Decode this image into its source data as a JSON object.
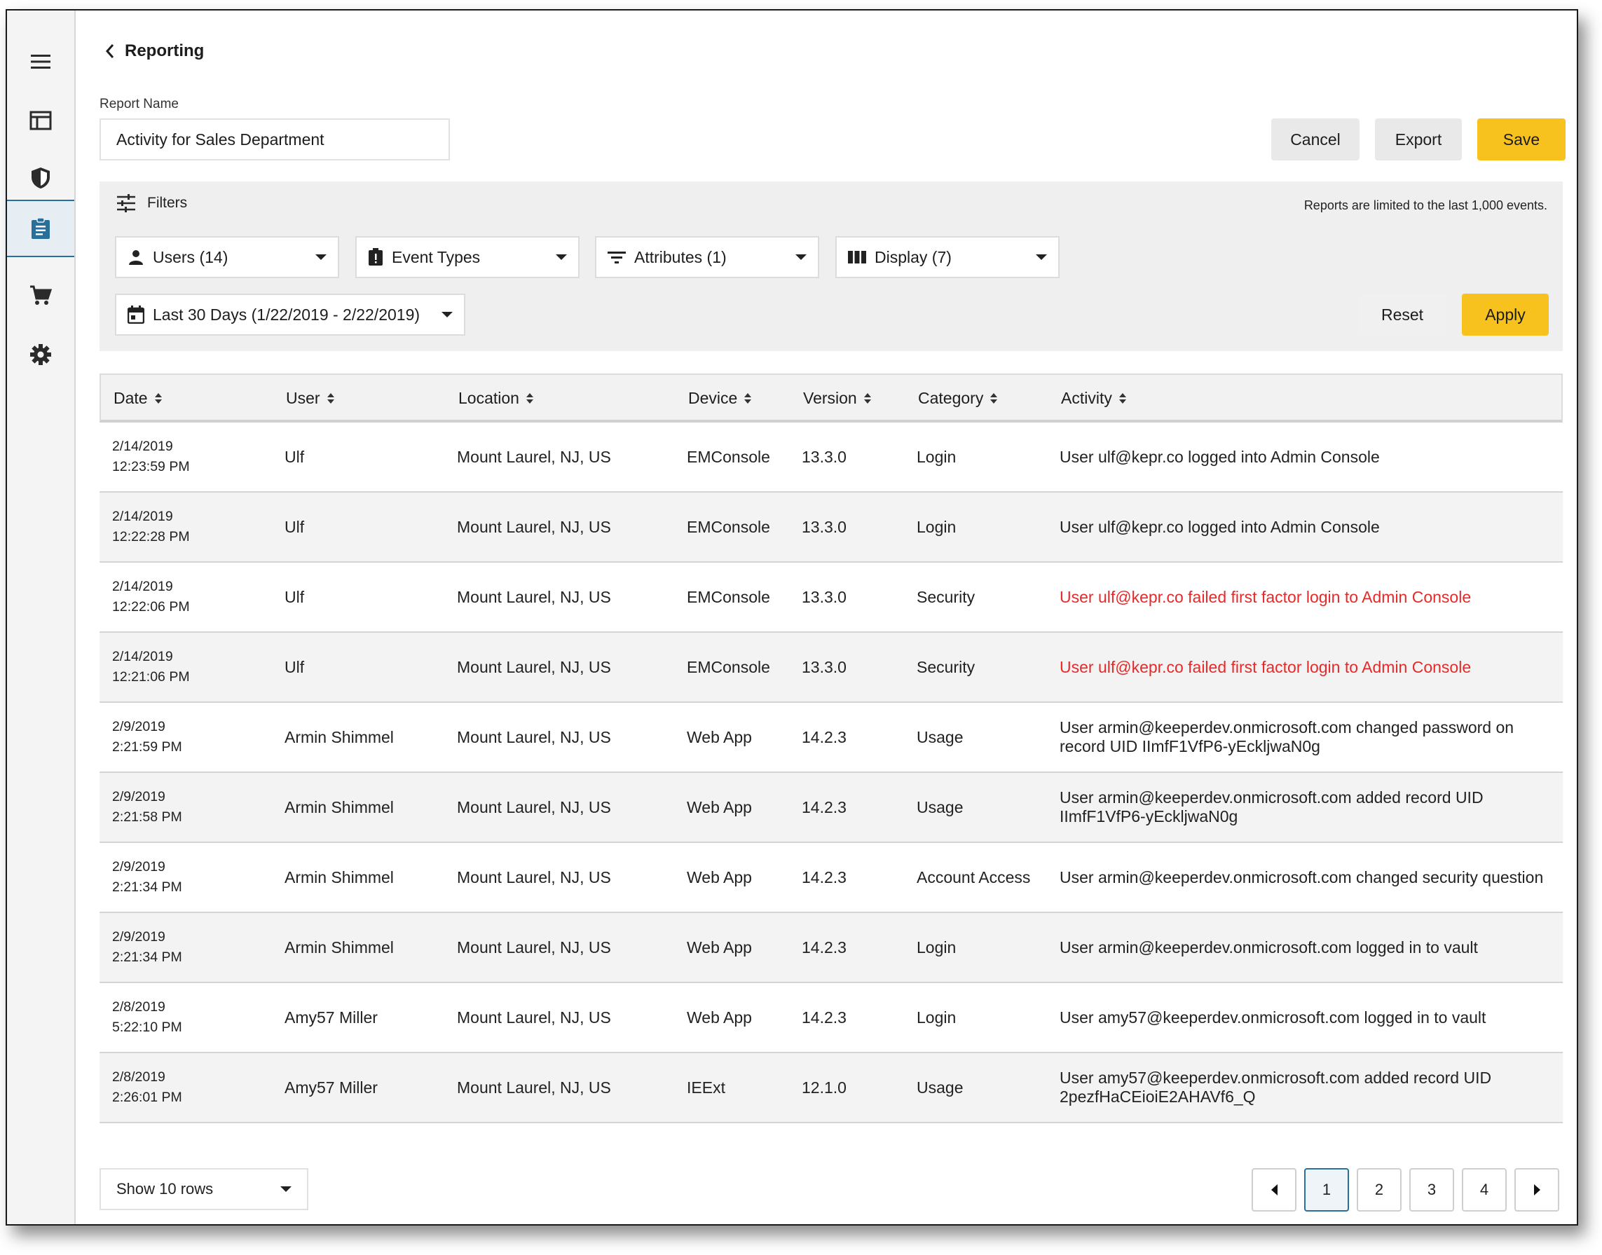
{
  "sidebar": {
    "items": [
      {
        "name": "menu-icon"
      },
      {
        "name": "dashboard-icon"
      },
      {
        "name": "shield-icon"
      },
      {
        "name": "reporting-clipboard-icon"
      },
      {
        "name": "cart-icon"
      },
      {
        "name": "settings-gear-icon"
      }
    ],
    "active_index": 3,
    "accent": "#2a6f99"
  },
  "header": {
    "back_title": "Reporting"
  },
  "report": {
    "label": "Report Name",
    "value": "Activity for Sales Department"
  },
  "actions": {
    "cancel": "Cancel",
    "export": "Export",
    "save": "Save"
  },
  "filters": {
    "title": "Filters",
    "note": "Reports are limited to the last 1,000 events.",
    "users": "Users (14)",
    "event_types": "Event Types",
    "attributes": "Attributes (1)",
    "display": "Display (7)",
    "date_range": "Last 30 Days (1/22/2019 - 2/22/2019)",
    "reset": "Reset",
    "apply": "Apply"
  },
  "table": {
    "columns": [
      "Date",
      "User",
      "Location",
      "Device",
      "Version",
      "Category",
      "Activity"
    ],
    "rows": [
      {
        "date": "2/14/2019",
        "time": "12:23:59 PM",
        "user": "Ulf",
        "location": "Mount Laurel, NJ, US",
        "device": "EMConsole",
        "version": "13.3.0",
        "category": "Login",
        "activity": "User ulf@kepr.co logged into Admin Console",
        "alert": false
      },
      {
        "date": "2/14/2019",
        "time": "12:22:28 PM",
        "user": "Ulf",
        "location": "Mount Laurel, NJ, US",
        "device": "EMConsole",
        "version": "13.3.0",
        "category": "Login",
        "activity": "User ulf@kepr.co logged into Admin Console",
        "alert": false
      },
      {
        "date": "2/14/2019",
        "time": "12:22:06 PM",
        "user": "Ulf",
        "location": "Mount Laurel, NJ, US",
        "device": "EMConsole",
        "version": "13.3.0",
        "category": "Security",
        "activity": "User ulf@kepr.co failed first factor login to Admin Console",
        "alert": true
      },
      {
        "date": "2/14/2019",
        "time": "12:21:06 PM",
        "user": "Ulf",
        "location": "Mount Laurel, NJ, US",
        "device": "EMConsole",
        "version": "13.3.0",
        "category": "Security",
        "activity": "User ulf@kepr.co failed first factor login to Admin Console",
        "alert": true
      },
      {
        "date": "2/9/2019",
        "time": "2:21:59 PM",
        "user": "Armin Shimmel",
        "location": "Mount Laurel, NJ, US",
        "device": "Web App",
        "version": "14.2.3",
        "category": "Usage",
        "activity": "User armin@keeperdev.onmicrosoft.com changed password on record UID IImfF1VfP6-yEckljwaN0g",
        "alert": false
      },
      {
        "date": "2/9/2019",
        "time": "2:21:58 PM",
        "user": "Armin Shimmel",
        "location": "Mount Laurel, NJ, US",
        "device": "Web App",
        "version": "14.2.3",
        "category": "Usage",
        "activity": "User armin@keeperdev.onmicrosoft.com added record UID IImfF1VfP6-yEckljwaN0g",
        "alert": false
      },
      {
        "date": "2/9/2019",
        "time": "2:21:34 PM",
        "user": "Armin Shimmel",
        "location": "Mount Laurel, NJ, US",
        "device": "Web App",
        "version": "14.2.3",
        "category": "Account Access",
        "activity": "User armin@keeperdev.onmicrosoft.com changed security question",
        "alert": false
      },
      {
        "date": "2/9/2019",
        "time": "2:21:34 PM",
        "user": "Armin Shimmel",
        "location": "Mount Laurel, NJ, US",
        "device": "Web App",
        "version": "14.2.3",
        "category": "Login",
        "activity": "User armin@keeperdev.onmicrosoft.com logged in to vault",
        "alert": false
      },
      {
        "date": "2/8/2019",
        "time": "5:22:10 PM",
        "user": "Amy57 Miller",
        "location": "Mount Laurel, NJ, US",
        "device": "Web App",
        "version": "14.2.3",
        "category": "Login",
        "activity": "User amy57@keeperdev.onmicrosoft.com logged in to vault",
        "alert": false
      },
      {
        "date": "2/8/2019",
        "time": "2:26:01 PM",
        "user": "Amy57 Miller",
        "location": "Mount Laurel, NJ, US",
        "device": "IEExt",
        "version": "12.1.0",
        "category": "Usage",
        "activity": "User amy57@keeperdev.onmicrosoft.com added record UID 2pezfHaCEioiE2AHAVf6_Q",
        "alert": false
      }
    ]
  },
  "footer": {
    "rows_select": "Show 10 rows",
    "pages": [
      "1",
      "2",
      "3",
      "4"
    ],
    "current_page": "1"
  },
  "colors": {
    "accent_yellow": "#f7c21e",
    "alert_red": "#e62a2a",
    "active_blue": "#2a6f99"
  }
}
